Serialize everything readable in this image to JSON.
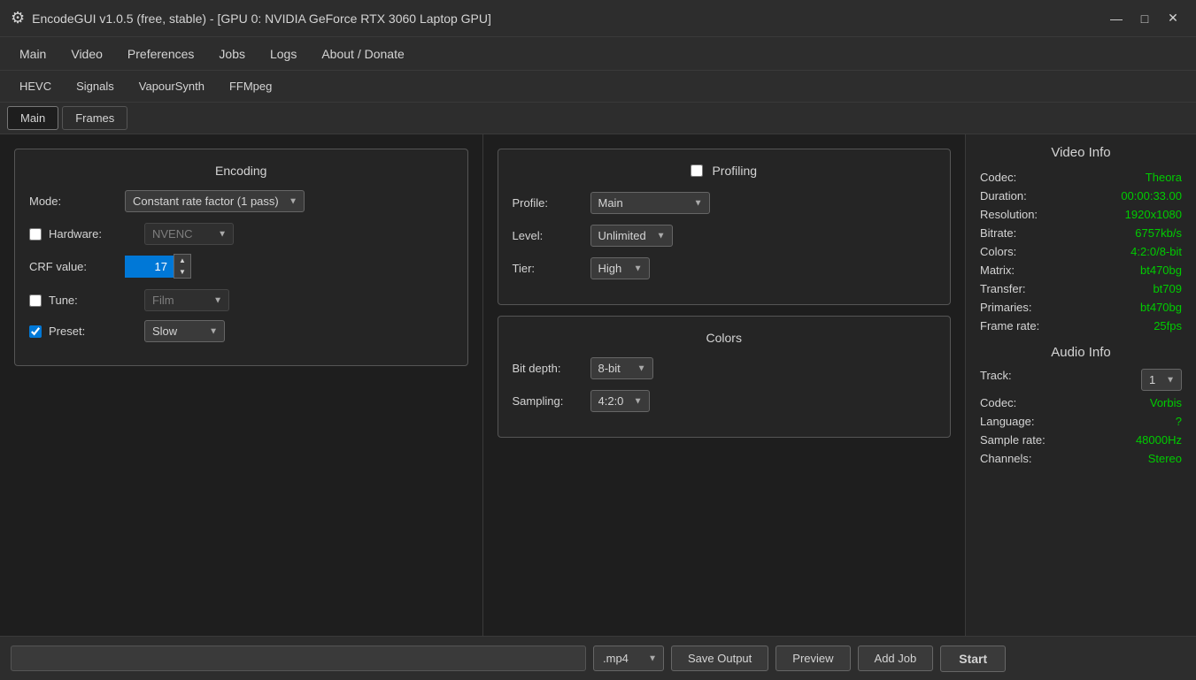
{
  "titleBar": {
    "icon": "⚙",
    "text": "EncodeGUI v1.0.5 (free, stable) - [GPU 0: NVIDIA GeForce RTX 3060 Laptop GPU]",
    "minimize": "—",
    "maximize": "□",
    "close": "✕"
  },
  "menuBar": {
    "items": [
      "Main",
      "Video",
      "Preferences",
      "Jobs",
      "Logs",
      "About / Donate"
    ]
  },
  "subTabs": {
    "items": [
      "HEVC",
      "Signals",
      "VapourSynth",
      "FFMpeg"
    ]
  },
  "subSubTabs": {
    "items": [
      "Main",
      "Frames"
    ],
    "active": "Main"
  },
  "encoding": {
    "sectionTitle": "Encoding",
    "modeLabel": "Mode:",
    "modeValue": "Constant rate factor (1 pass)",
    "hardwareLabel": "Hardware:",
    "hardwareValue": "NVENC",
    "hardwareChecked": false,
    "crfLabel": "CRF value:",
    "crfValue": "17",
    "tuneLabel": "Tune:",
    "tuneValue": "Film",
    "tuneChecked": false,
    "presetLabel": "Preset:",
    "presetValue": "Slow",
    "presetChecked": true
  },
  "profiling": {
    "checkboxLabel": "Profiling",
    "profileLabel": "Profile:",
    "profileValue": "Main",
    "levelLabel": "Level:",
    "levelValue": "Unlimited",
    "tierLabel": "Tier:",
    "tierValue": "High"
  },
  "colors": {
    "sectionTitle": "Colors",
    "bitDepthLabel": "Bit depth:",
    "bitDepthValue": "8-bit",
    "samplingLabel": "Sampling:",
    "samplingValue": "4:2:0"
  },
  "videoInfo": {
    "title": "Video Info",
    "codecLabel": "Codec:",
    "codecValue": "Theora",
    "durationLabel": "Duration:",
    "durationValue": "00:00:33.00",
    "resolutionLabel": "Resolution:",
    "resolutionValue": "1920x1080",
    "bitrateLabel": "Bitrate:",
    "bitrateValue": "6757kb/s",
    "colorsLabel": "Colors:",
    "colorsValue": "4:2:0/8-bit",
    "matrixLabel": "Matrix:",
    "matrixValue": "bt470bg",
    "transferLabel": "Transfer:",
    "transferValue": "bt709",
    "primariesLabel": "Primaries:",
    "primariesValue": "bt470bg",
    "frameRateLabel": "Frame rate:",
    "frameRateValue": "25fps"
  },
  "audioInfo": {
    "title": "Audio Info",
    "trackLabel": "Track:",
    "trackValue": "1",
    "codecLabel": "Codec:",
    "codecValue": "Vorbis",
    "languageLabel": "Language:",
    "languageValue": "?",
    "sampleRateLabel": "Sample rate:",
    "sampleRateValue": "48000Hz",
    "channelsLabel": "Channels:",
    "channelsValue": "Stereo"
  },
  "bottomBar": {
    "outputPlaceholder": "",
    "formatValue": ".mp4",
    "saveOutputLabel": "Save Output",
    "previewLabel": "Preview",
    "addJobLabel": "Add Job",
    "startLabel": "Start"
  }
}
